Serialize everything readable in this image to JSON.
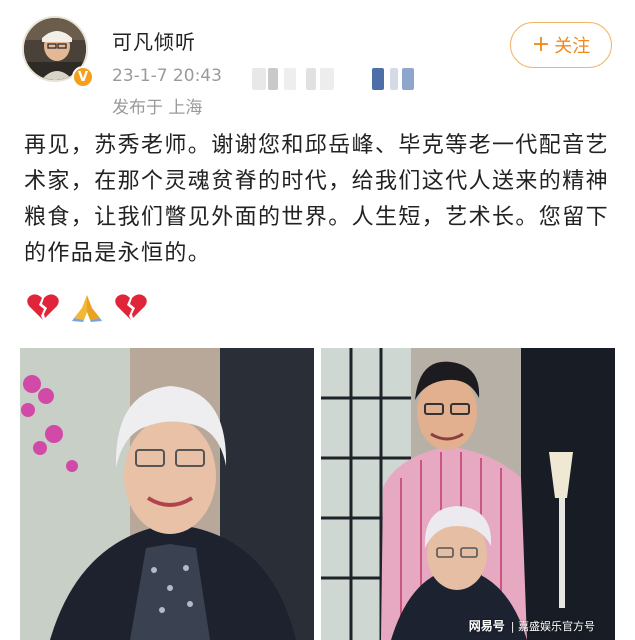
{
  "post": {
    "author": "可凡倾听",
    "verified_badge": "V",
    "time": "23-1-7 20:43",
    "location": "发布于 上海",
    "follow_label": "关注",
    "follow_plus": "+",
    "text": "再见，苏秀老师。谢谢您和邱岳峰、毕克等老一代配音艺术家，在那个灵魂贫脊的时代，给我们这代人送来的精神粮食，让我们瞥见外面的世界。人生短，艺术长。您留下的作品是永恒的。",
    "emojis": [
      "broken-heart-icon",
      "folded-hands-icon",
      "broken-heart-icon"
    ]
  },
  "watermark": {
    "brand": "网易号",
    "channel": "| 嘉盛娱乐官方号"
  },
  "colors": {
    "accent": "#ef8a1d",
    "follow_border": "#f3b56b",
    "meta_text": "#9a9a9a",
    "badge": "#f59f1a"
  }
}
